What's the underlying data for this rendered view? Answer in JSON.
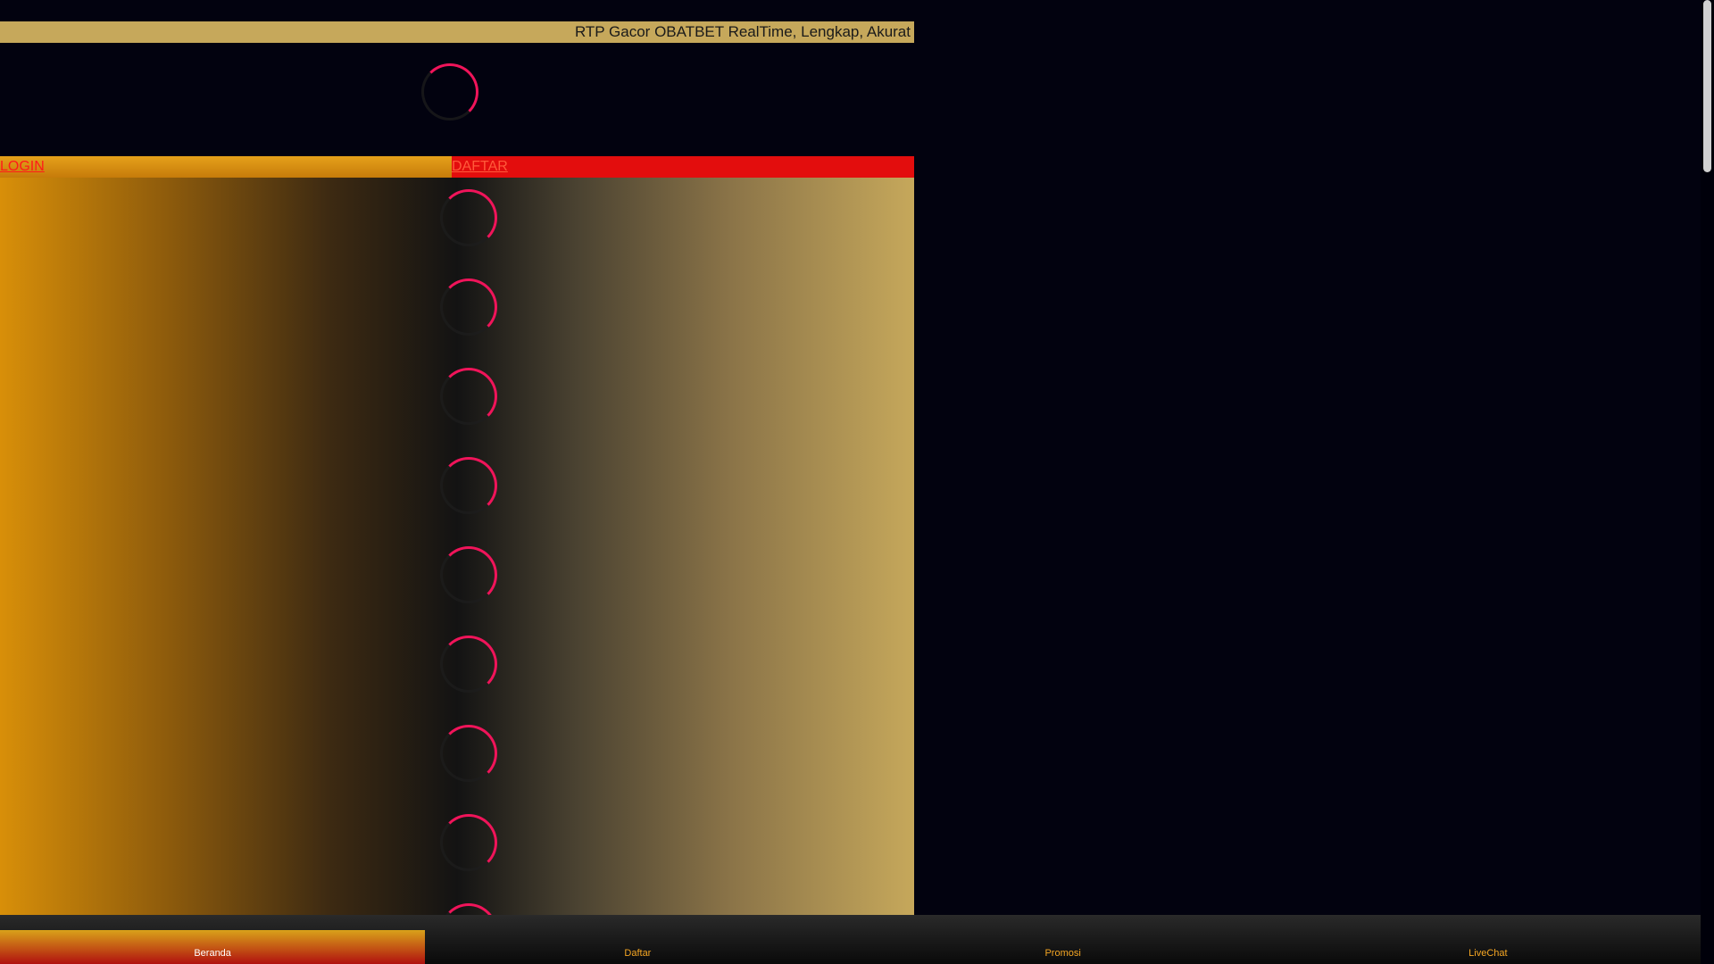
{
  "marquee": {
    "text": "RTP Gacor OBATBET RealTime, Lengkap, Akurat"
  },
  "auth": {
    "login_label": "LOGIN",
    "register_label": "DAFTAR"
  },
  "content": {
    "loading_items": 9
  },
  "bottom_nav": {
    "items": [
      {
        "label": "Beranda",
        "icon": "home-icon",
        "active": true
      },
      {
        "label": "Daftar",
        "icon": "register-icon",
        "active": false
      },
      {
        "label": "Promosi",
        "icon": "gift-icon",
        "active": false
      },
      {
        "label": "LiveChat",
        "icon": "chat-icon",
        "active": false
      }
    ]
  },
  "colors": {
    "page_bg": "#02020f",
    "marquee_bg": "#c6a85b",
    "login_bg": "#e6a11a",
    "daftar_bg": "#e30d0d",
    "spinner": "#f0145a",
    "nav_text": "#f5a623"
  }
}
